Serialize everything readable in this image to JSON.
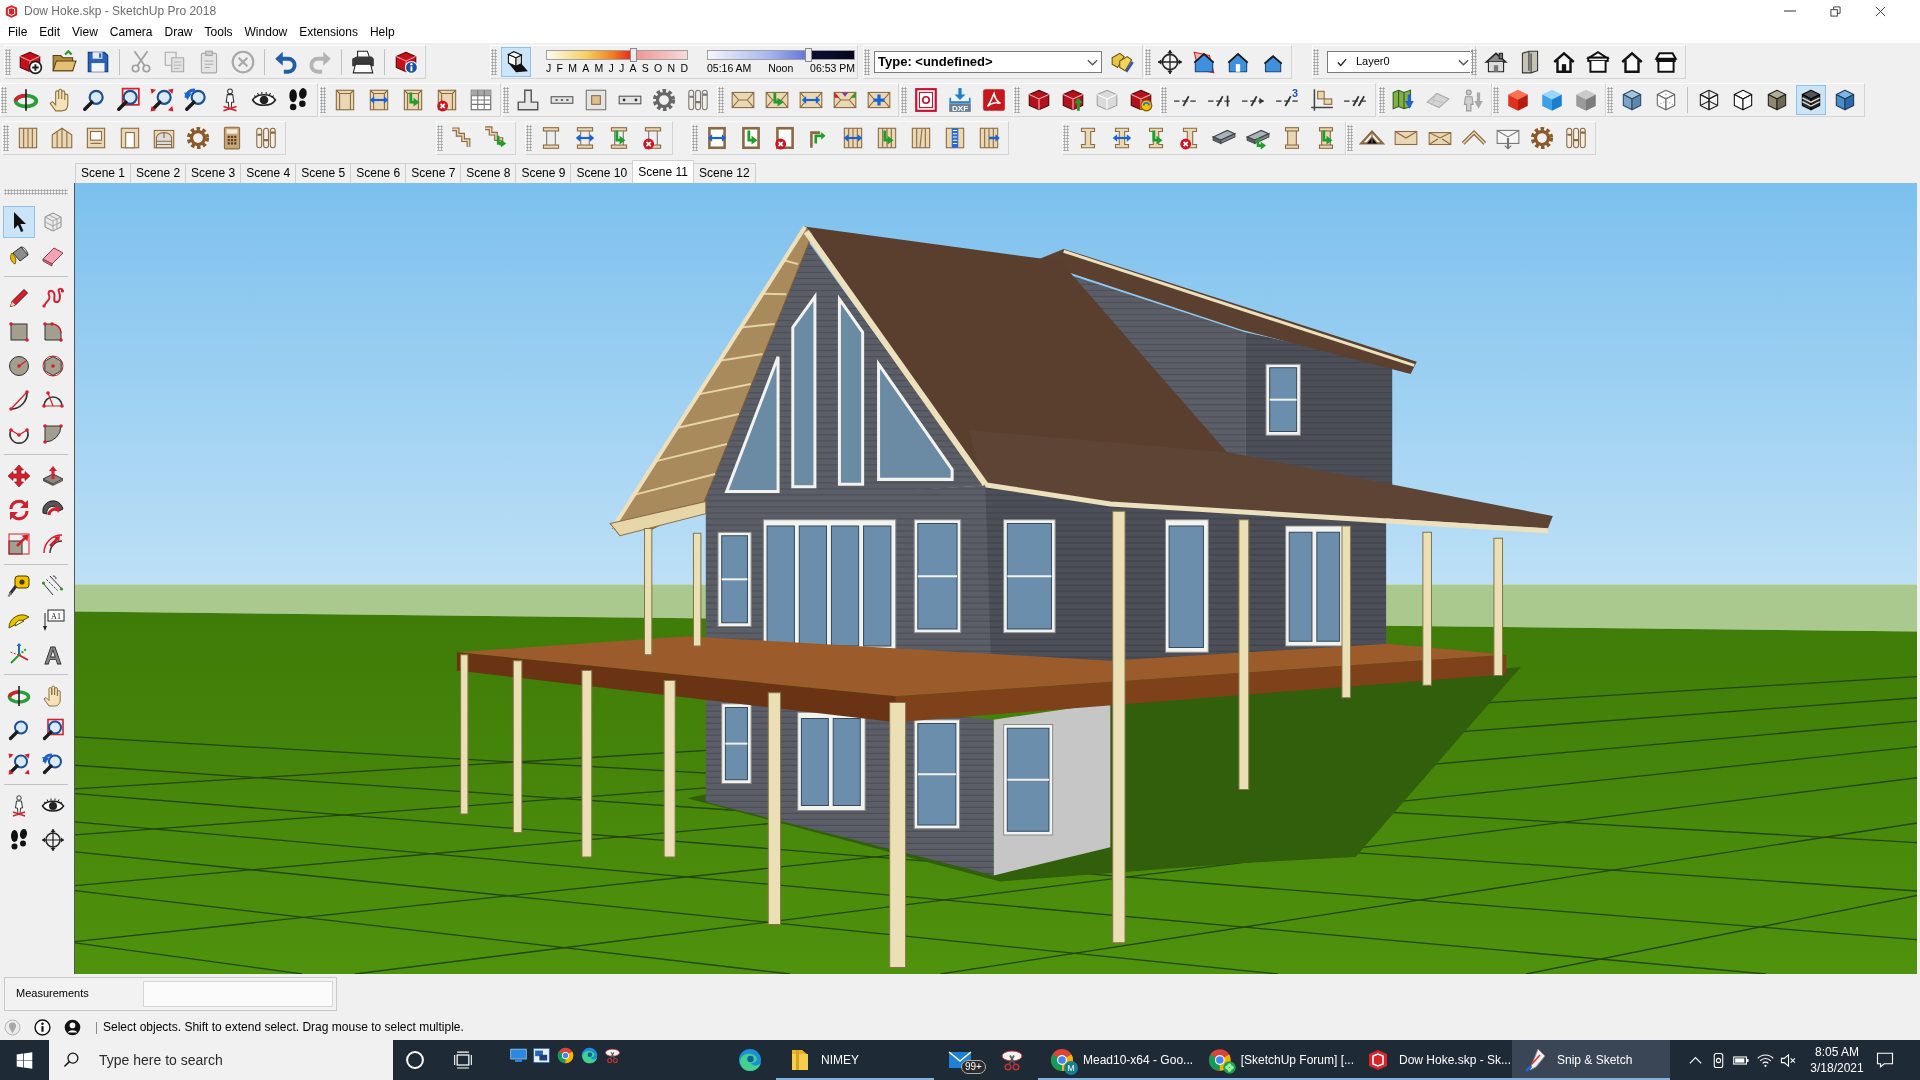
{
  "window": {
    "title": "Dow Hoke.skp - SketchUp Pro 2018"
  },
  "menu": [
    "File",
    "Edit",
    "View",
    "Camera",
    "Draw",
    "Tools",
    "Window",
    "Extensions",
    "Help"
  ],
  "shadows": {
    "on": true,
    "date_slider": {
      "level": 0.62,
      "months": [
        "J",
        "F",
        "M",
        "A",
        "M",
        "J",
        "J",
        "A",
        "S",
        "O",
        "N",
        "D"
      ]
    },
    "time_slider": {
      "level": 0.69,
      "start": "05:16 AM",
      "middle": "Noon",
      "end": "06:53 PM"
    }
  },
  "entity_info": {
    "value": "Type: <undefined>"
  },
  "layer": {
    "value": "Layer0",
    "checked": true
  },
  "icon_labels": {
    "dxf": "DXF",
    "dimension_count": "3"
  },
  "face_styles": [
    {
      "selected": false
    },
    {
      "selected": false
    },
    {
      "selected": false
    },
    {
      "selected": true
    },
    {
      "selected": false
    }
  ],
  "scenes": [
    {
      "label": "Scene 1",
      "selected": false
    },
    {
      "label": "Scene 2",
      "selected": false
    },
    {
      "label": "Scene 3",
      "selected": false
    },
    {
      "label": "Scene 4",
      "selected": false
    },
    {
      "label": "Scene 5",
      "selected": false
    },
    {
      "label": "Scene 6",
      "selected": false
    },
    {
      "label": "Scene 7",
      "selected": false
    },
    {
      "label": "Scene 8",
      "selected": false
    },
    {
      "label": "Scene 9",
      "selected": false
    },
    {
      "label": "Scene 10",
      "selected": false
    },
    {
      "label": "Scene 11",
      "selected": true
    },
    {
      "label": "Scene 12",
      "selected": false
    }
  ],
  "tools": [
    {
      "selected": true
    },
    {
      "selected": false
    },
    {
      "selected": false
    },
    {
      "selected": false
    },
    {
      "selected": false
    },
    {
      "selected": false
    },
    {
      "selected": false
    },
    {
      "selected": false
    },
    {
      "selected": false
    },
    {
      "selected": false
    },
    {
      "selected": false
    },
    {
      "selected": false
    },
    {
      "selected": false
    },
    {
      "selected": false
    },
    {
      "selected": false
    },
    {
      "selected": false
    },
    {
      "selected": false
    },
    {
      "selected": false
    },
    {
      "selected": false
    },
    {
      "selected": false
    },
    {
      "selected": false
    },
    {
      "selected": false
    },
    {
      "selected": false
    },
    {
      "selected": false,
      "label": "A1"
    },
    {
      "selected": false
    },
    {
      "selected": false,
      "label": "A"
    },
    {
      "selected": false
    },
    {
      "selected": false
    },
    {
      "selected": false
    },
    {
      "selected": false
    },
    {
      "selected": false
    },
    {
      "selected": false
    },
    {
      "selected": false
    },
    {
      "selected": false
    },
    {
      "selected": false
    },
    {
      "selected": false
    }
  ],
  "measurements": {
    "label": "Measurements"
  },
  "status_bar": {
    "text": "Select objects. Shift to extend select. Drag mouse to select multiple."
  },
  "taskbar": {
    "search": {
      "placeholder": "Type here to search"
    },
    "apps": [
      {
        "kind": "edge",
        "running": false,
        "selected": false
      },
      {
        "kind": "folder",
        "label": "NIMEY",
        "running": true,
        "selected": false
      },
      {
        "kind": "mail",
        "badge": "99+",
        "running": false,
        "selected": false
      },
      {
        "kind": "snipping",
        "running": false,
        "selected": false
      },
      {
        "kind": "chrome",
        "label": "Mead10-x64 - Goo...",
        "avatar": "M",
        "running": true,
        "selected": false
      },
      {
        "kind": "chrome-clover",
        "label": "[SketchUp Forum] [...",
        "running": true,
        "selected": false
      },
      {
        "kind": "sketchup",
        "label": "Dow Hoke.skp - Sk...",
        "running": true,
        "selected": false
      },
      {
        "kind": "snip-sketch",
        "label": "Snip & Sketch",
        "running": true,
        "selected": true
      }
    ],
    "clock": {
      "time": "8:05 AM",
      "date": "3/18/2021"
    }
  }
}
